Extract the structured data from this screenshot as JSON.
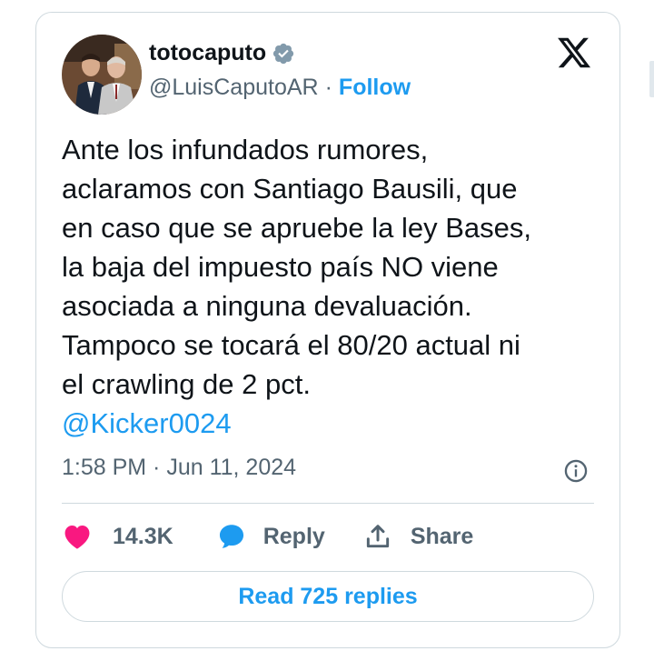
{
  "author": {
    "display_name": "totocaputo",
    "handle": "@LuisCaputoAR",
    "separator": "·",
    "follow_label": "Follow",
    "verified_color": "#829aab"
  },
  "tweet": {
    "lines": [
      "Ante los infundados rumores,",
      "aclaramos con Santiago Bausili, que",
      "en caso que se apruebe la ley Bases,",
      "la baja del impuesto país NO viene",
      "asociada a ninguna devaluación.",
      "Tampoco se tocará el 80/20 actual ni",
      "el crawling de 2 pct."
    ],
    "mention": "@Kicker0024",
    "timestamp": "1:58 PM · Jun 11, 2024"
  },
  "actions": {
    "likes": "14.3K",
    "reply_label": "Reply",
    "share_label": "Share"
  },
  "read_replies_label": "Read 725 replies",
  "colors": {
    "accent": "#1d9bf0",
    "like": "#f91880",
    "text": "#0f1419",
    "muted": "#536471",
    "border": "#cfd9de"
  },
  "icons": [
    "verified-badge-icon",
    "x-logo-icon",
    "info-icon",
    "heart-icon",
    "reply-bubble-icon",
    "share-icon"
  ]
}
